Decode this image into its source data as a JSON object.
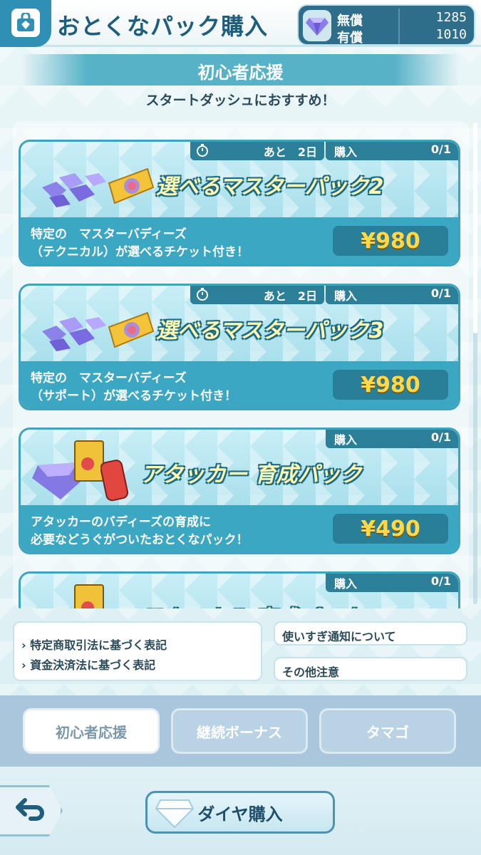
{
  "header": {
    "title": "おとくなパック購入",
    "currency": {
      "free_label": "無償",
      "free_value": "1285",
      "paid_label": "有償",
      "paid_value": "1010"
    }
  },
  "section": {
    "title": "初心者応援",
    "subtitle": "スタートダッシュにおすすめ！"
  },
  "packs": [
    {
      "title": "選べるマスターパック2",
      "timer": "あと　2日",
      "buy_label": "購入",
      "buy_count": "0/1",
      "desc_line1": "特定の　マスターバディーズ",
      "desc_line2": "（テクニカル）が選べるチケット付き！",
      "price": "¥980"
    },
    {
      "title": "選べるマスターパック3",
      "timer": "あと　2日",
      "buy_label": "購入",
      "buy_count": "0/1",
      "desc_line1": "特定の　マスターバディーズ",
      "desc_line2": "（サポート）が選べるチケット付き！",
      "price": "¥980"
    },
    {
      "title": "アタッカー 育成パック",
      "buy_label": "購入",
      "buy_count": "0/1",
      "desc_line1": "アタッカーのバディーズの育成に",
      "desc_line2": "必要などうぐがついたおとくなパック！",
      "price": "¥490"
    },
    {
      "title": "テクニカル 育成パック",
      "buy_label": "購入",
      "buy_count": "0/1"
    }
  ],
  "notices": {
    "tokutei": "特定商取引法に基づく表記",
    "shikin": "資金決済法に基づく表記",
    "overuse": "使いすぎ通知について",
    "other": "その他注意"
  },
  "tabs": [
    "初心者応援",
    "継続ボーナス",
    "タマゴ"
  ],
  "bottom": {
    "diamond_label": "ダイヤ購入"
  },
  "colors": {
    "accent": "#3ca7c2",
    "price": "#ffd94a",
    "header_title": "#1f5d7d"
  },
  "icons": {
    "header": "shop-bag-icon",
    "currency": "diamond-icon",
    "back": "back-arrow-icon",
    "timer": "stopwatch-icon"
  }
}
